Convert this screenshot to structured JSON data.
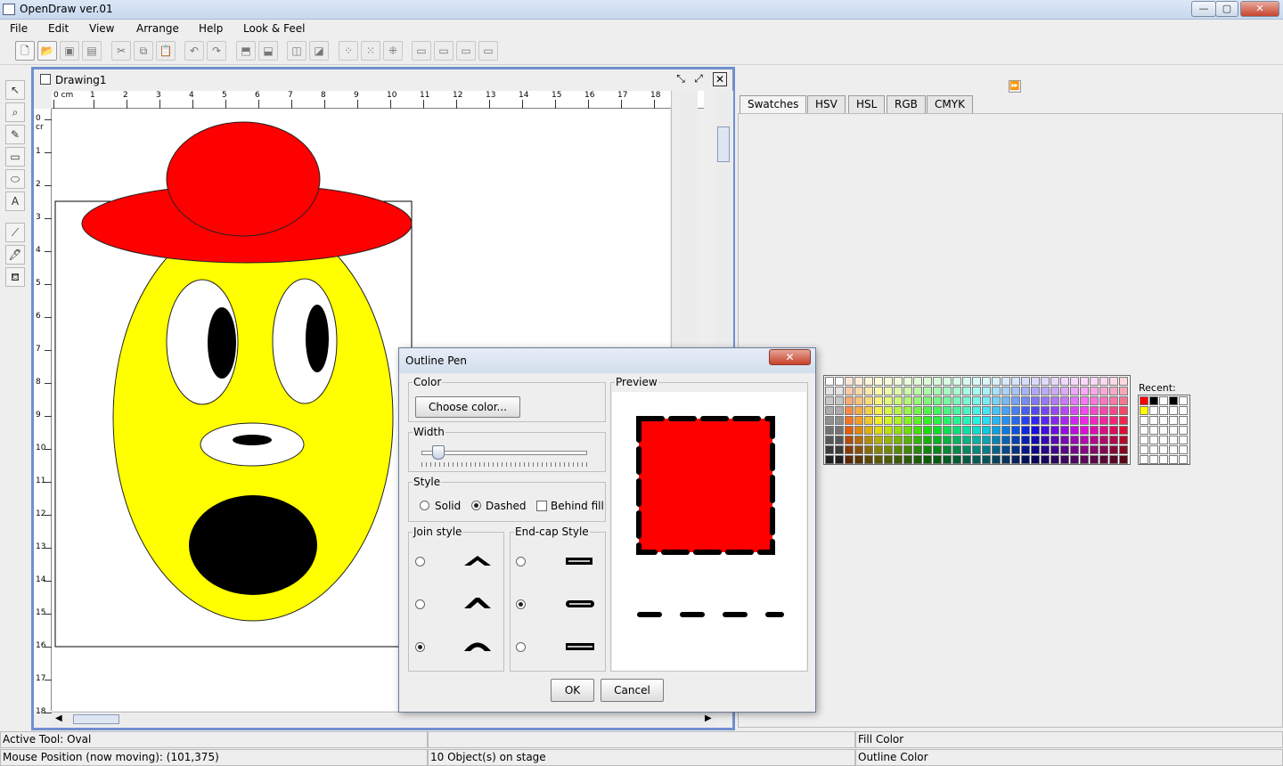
{
  "app": {
    "title": "OpenDraw ver.01"
  },
  "window_controls": {
    "minimize": "—",
    "maximize": "▢",
    "close": "✕"
  },
  "menu": [
    "File",
    "Edit",
    "View",
    "Arrange",
    "Help",
    "Look & Feel"
  ],
  "drawing": {
    "title": "Drawing1",
    "ruler_h_labels": [
      "0 cm",
      "1",
      "2",
      "3",
      "4",
      "5",
      "6",
      "7",
      "8",
      "9",
      "10",
      "11",
      "12",
      "13",
      "14",
      "15",
      "16",
      "17",
      "18",
      "2"
    ],
    "ruler_v_labels": [
      "0 cr",
      "1",
      "2",
      "3",
      "4",
      "5",
      "6",
      "7",
      "8",
      "9",
      "10",
      "11",
      "12",
      "13",
      "14",
      "15",
      "16",
      "17",
      "18"
    ]
  },
  "color_panel": {
    "tabs": [
      "Swatches",
      "HSV",
      "HSL",
      "RGB",
      "CMYK"
    ],
    "active_tab": "Swatches",
    "recent_label": "Recent:",
    "collapse_glyph": "⏩"
  },
  "dialog": {
    "title": "Outline Pen",
    "close_glyph": "✕",
    "color_group": "Color",
    "choose_color": "Choose color...",
    "width_group": "Width",
    "style_group": "Style",
    "style_solid": "Solid",
    "style_dashed": "Dashed",
    "behind_fill": "Behind fill",
    "join_group": "Join style",
    "endcap_group": "End-cap Style",
    "preview_group": "Preview",
    "ok": "OK",
    "cancel": "Cancel",
    "selected_style": "Dashed",
    "selected_join_index": 2,
    "selected_endcap_index": 1,
    "preview_fill": "#ff0000"
  },
  "status": {
    "active_tool": "Active Tool: Oval",
    "mouse_position": "Mouse Position (now moving): (101,375)",
    "object_count": "10 Object(s) on stage",
    "fill_color": "Fill Color",
    "outline_color": "Outline Color"
  },
  "colors": {
    "accent_frame": "#6f8fcf",
    "hat": "#ff0000",
    "face": "#ffff00"
  }
}
